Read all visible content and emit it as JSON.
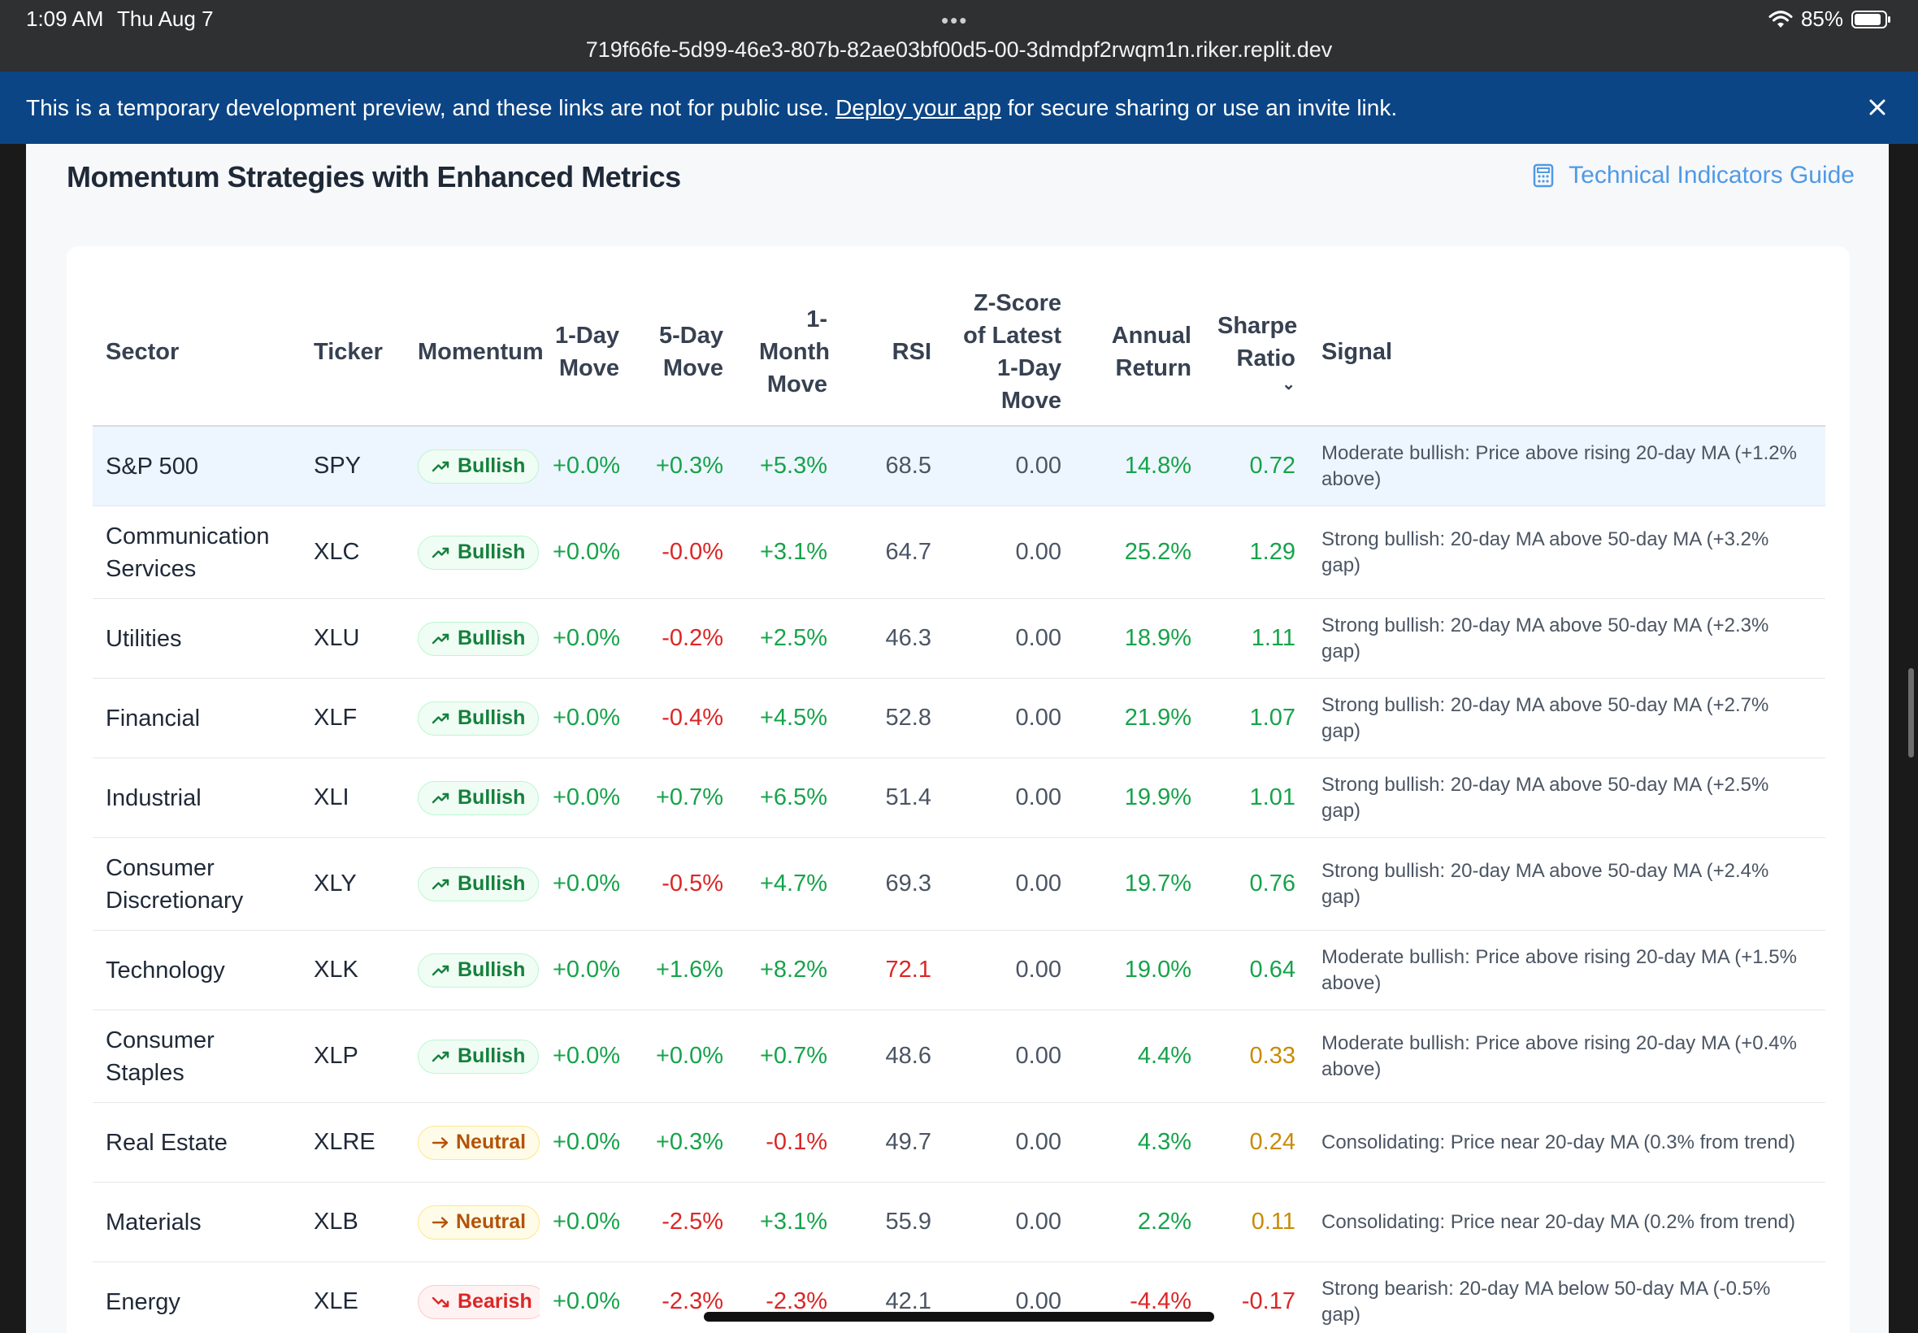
{
  "status_bar": {
    "time": "1:09 AM",
    "date": "Thu Aug 7",
    "dots": "•••",
    "url": "719f66fe-5d99-46e3-807b-82ae03bf00d5-00-3dmdpf2rwqm1n.riker.replit.dev",
    "battery": "85%"
  },
  "banner": {
    "text_before": "This is a temporary development preview, and these links are not for public use.",
    "link": "Deploy your app",
    "text_after": "for secure sharing or use an invite link."
  },
  "section": {
    "title": "Momentum Strategies with Enhanced Metrics",
    "guide_link": "Technical Indicators Guide"
  },
  "table": {
    "headers": {
      "sector": "Sector",
      "ticker": "Ticker",
      "momentum": "Momentum",
      "one_day": "1-Day Move",
      "five_day": "5-Day Move",
      "one_month": "1-Month Move",
      "rsi": "RSI",
      "zscore": "Z-Score of Latest 1-Day Move",
      "annual": "Annual Return",
      "sharpe": "Sharpe Ratio",
      "signal": "Signal"
    },
    "rows": [
      {
        "sector": "S&P 500",
        "ticker": "SPY",
        "momentum": "Bullish",
        "one_day": "+0.0%",
        "five_day": "+0.3%",
        "one_month": "+5.3%",
        "rsi": "68.5",
        "zscore": "0.00",
        "annual": "14.8%",
        "sharpe": "0.72",
        "signal": "Moderate bullish: Price above rising 20-day MA (+1.2% above)"
      },
      {
        "sector": "Communication Services",
        "ticker": "XLC",
        "momentum": "Bullish",
        "one_day": "+0.0%",
        "five_day": "-0.0%",
        "one_month": "+3.1%",
        "rsi": "64.7",
        "zscore": "0.00",
        "annual": "25.2%",
        "sharpe": "1.29",
        "signal": "Strong bullish: 20-day MA above 50-day MA (+3.2% gap)"
      },
      {
        "sector": "Utilities",
        "ticker": "XLU",
        "momentum": "Bullish",
        "one_day": "+0.0%",
        "five_day": "-0.2%",
        "one_month": "+2.5%",
        "rsi": "46.3",
        "zscore": "0.00",
        "annual": "18.9%",
        "sharpe": "1.11",
        "signal": "Strong bullish: 20-day MA above 50-day MA (+2.3% gap)"
      },
      {
        "sector": "Financial",
        "ticker": "XLF",
        "momentum": "Bullish",
        "one_day": "+0.0%",
        "five_day": "-0.4%",
        "one_month": "+4.5%",
        "rsi": "52.8",
        "zscore": "0.00",
        "annual": "21.9%",
        "sharpe": "1.07",
        "signal": "Strong bullish: 20-day MA above 50-day MA (+2.7% gap)"
      },
      {
        "sector": "Industrial",
        "ticker": "XLI",
        "momentum": "Bullish",
        "one_day": "+0.0%",
        "five_day": "+0.7%",
        "one_month": "+6.5%",
        "rsi": "51.4",
        "zscore": "0.00",
        "annual": "19.9%",
        "sharpe": "1.01",
        "signal": "Strong bullish: 20-day MA above 50-day MA (+2.5% gap)"
      },
      {
        "sector": "Consumer Discretionary",
        "ticker": "XLY",
        "momentum": "Bullish",
        "one_day": "+0.0%",
        "five_day": "-0.5%",
        "one_month": "+4.7%",
        "rsi": "69.3",
        "zscore": "0.00",
        "annual": "19.7%",
        "sharpe": "0.76",
        "signal": "Strong bullish: 20-day MA above 50-day MA (+2.4% gap)"
      },
      {
        "sector": "Technology",
        "ticker": "XLK",
        "momentum": "Bullish",
        "one_day": "+0.0%",
        "five_day": "+1.6%",
        "one_month": "+8.2%",
        "rsi": "72.1",
        "zscore": "0.00",
        "annual": "19.0%",
        "sharpe": "0.64",
        "signal": "Moderate bullish: Price above rising 20-day MA (+1.5% above)"
      },
      {
        "sector": "Consumer Staples",
        "ticker": "XLP",
        "momentum": "Bullish",
        "one_day": "+0.0%",
        "five_day": "+0.0%",
        "one_month": "+0.7%",
        "rsi": "48.6",
        "zscore": "0.00",
        "annual": "4.4%",
        "sharpe": "0.33",
        "signal": "Moderate bullish: Price above rising 20-day MA (+0.4% above)"
      },
      {
        "sector": "Real Estate",
        "ticker": "XLRE",
        "momentum": "Neutral",
        "one_day": "+0.0%",
        "five_day": "+0.3%",
        "one_month": "-0.1%",
        "rsi": "49.7",
        "zscore": "0.00",
        "annual": "4.3%",
        "sharpe": "0.24",
        "signal": "Consolidating: Price near 20-day MA (0.3% from trend)"
      },
      {
        "sector": "Materials",
        "ticker": "XLB",
        "momentum": "Neutral",
        "one_day": "+0.0%",
        "five_day": "-2.5%",
        "one_month": "+3.1%",
        "rsi": "55.9",
        "zscore": "0.00",
        "annual": "2.2%",
        "sharpe": "0.11",
        "signal": "Consolidating: Price near 20-day MA (0.2% from trend)"
      },
      {
        "sector": "Energy",
        "ticker": "XLE",
        "momentum": "Bearish",
        "one_day": "+0.0%",
        "five_day": "-2.3%",
        "one_month": "-2.3%",
        "rsi": "42.1",
        "zscore": "0.00",
        "annual": "-4.4%",
        "sharpe": "-0.17",
        "signal": "Strong bearish: 20-day MA below 50-day MA (-0.5% gap)"
      }
    ]
  },
  "colors": {
    "positive": "#16a34a",
    "negative": "#dc2626",
    "warning": "#ca8a04",
    "link": "#4f9ae6",
    "banner": "#0b4585"
  }
}
